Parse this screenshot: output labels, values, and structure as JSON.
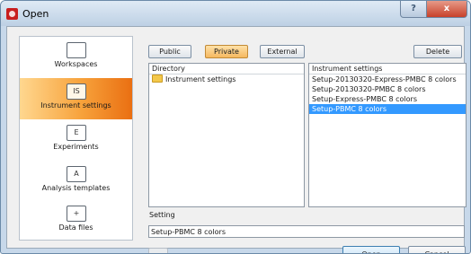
{
  "window": {
    "title": "Open",
    "help_glyph": "?",
    "close_glyph": "x"
  },
  "sidebar": {
    "items": [
      {
        "label": "Workspaces",
        "icon": "folder-icon",
        "glyph": ""
      },
      {
        "label": "Instrument settings",
        "icon": "instrument-settings-icon",
        "glyph": "IS"
      },
      {
        "label": "Experiments",
        "icon": "experiments-icon",
        "glyph": "E"
      },
      {
        "label": "Analysis templates",
        "icon": "analysis-templates-icon",
        "glyph": "A"
      },
      {
        "label": "Data files",
        "icon": "data-files-icon",
        "glyph": "+"
      }
    ],
    "active_index": 1
  },
  "toolbar": {
    "public_label": "Public",
    "private_label": "Private",
    "external_label": "External",
    "delete_label": "Delete"
  },
  "directory": {
    "header": "Directory",
    "items": [
      "Instrument settings"
    ]
  },
  "instrument_settings": {
    "header": "Instrument settings",
    "items": [
      "Setup-20130320-Express-PMBC 8 colors",
      "Setup-20130320-PMBC 8 colors",
      "Setup-Express-PMBC 8 colors",
      "Setup-PBMC 8 colors"
    ],
    "selected_index": 3
  },
  "setting": {
    "label": "Setting",
    "value": "Setup-PBMC 8 colors"
  },
  "footer": {
    "small_button_label": "...",
    "open_label": "Open",
    "cancel_label": "Cancel"
  },
  "colors": {
    "accent_orange": "#f7a23b",
    "selection_blue": "#3399ff",
    "close_red": "#c7412a"
  }
}
